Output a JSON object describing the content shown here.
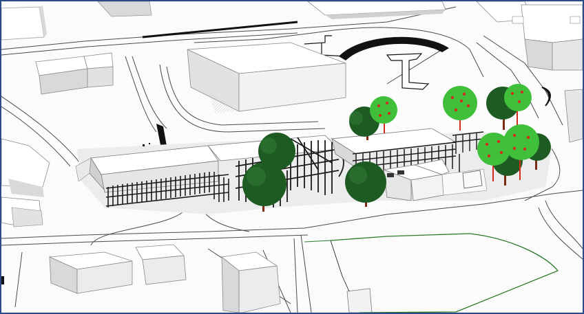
{
  "viewport": {
    "view_type": "3d-perspective-shaded",
    "frame_color": "#2b4a8b",
    "colors": {
      "background": "#fbfbfb",
      "building_roof": "#ffffff",
      "building_side": "#d9d9d9",
      "building_shadow": "#bdbdbd",
      "road_edge": "#3a3a3a",
      "curb_black": "#111111",
      "tree_canopy_dark": "#1e5b23",
      "tree_canopy_light": "#3fbf3a",
      "tree_fruit": "#d42a1e",
      "tree_trunk": "#7a2a12",
      "field_boundary": "#2a7a2a",
      "timber_frame": "#1a1a1a"
    },
    "icons": [
      "tree-icon",
      "building-icon",
      "road-icon",
      "field-icon"
    ]
  }
}
